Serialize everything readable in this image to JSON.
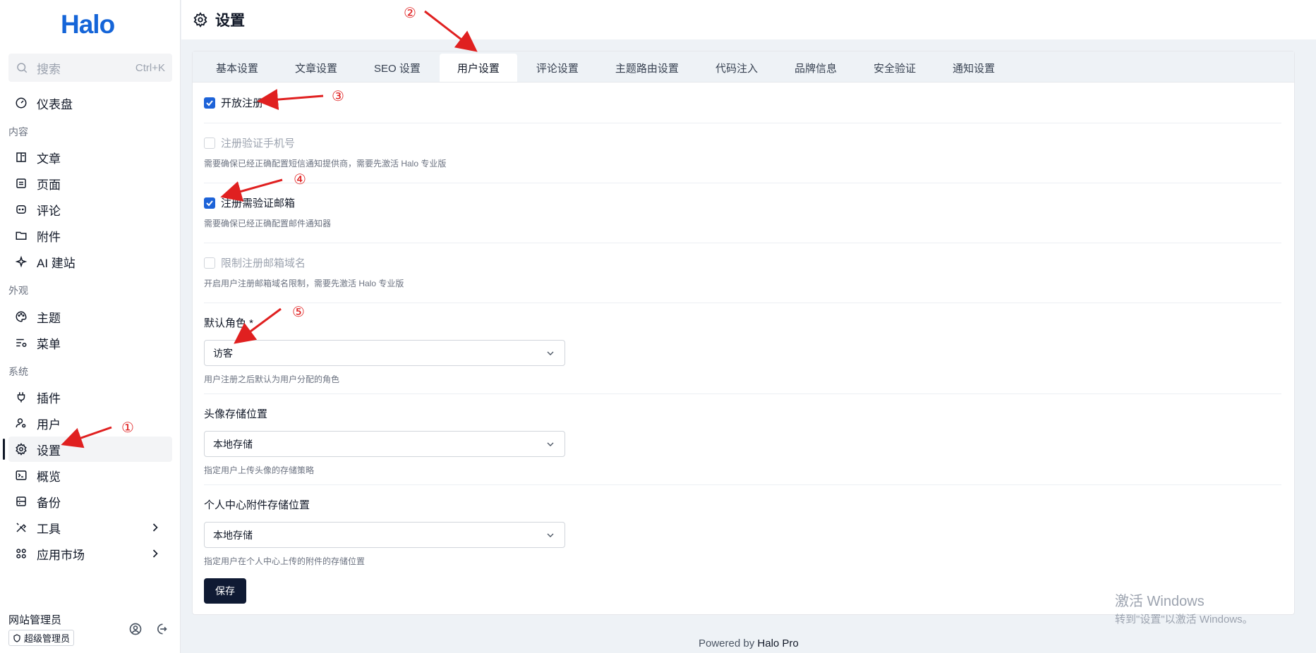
{
  "sidebar": {
    "logo": "Halo",
    "search": {
      "placeholder": "搜索",
      "shortcut": "Ctrl+K"
    },
    "dashboard": "仪表盘",
    "groups": {
      "content": "内容",
      "appearance": "外观",
      "system": "系统"
    },
    "items": {
      "posts": "文章",
      "pages": "页面",
      "comments": "评论",
      "attachments": "附件",
      "ai": "AI 建站",
      "themes": "主题",
      "menus": "菜单",
      "plugins": "插件",
      "users": "用户",
      "settings": "设置",
      "overview": "概览",
      "backup": "备份",
      "tools": "工具",
      "market": "应用市场"
    },
    "user": {
      "name": "网站管理员",
      "role": "超级管理员"
    }
  },
  "header": {
    "title": "设置"
  },
  "tabs": [
    "基本设置",
    "文章设置",
    "SEO 设置",
    "用户设置",
    "评论设置",
    "主题路由设置",
    "代码注入",
    "品牌信息",
    "安全验证",
    "通知设置"
  ],
  "active_tab": "用户设置",
  "form": {
    "open_registration": {
      "label": "开放注册",
      "checked": true
    },
    "phone_verify": {
      "label": "注册验证手机号",
      "checked": false,
      "help": "需要确保已经正确配置短信通知提供商，需要先激活 Halo 专业版"
    },
    "email_verify": {
      "label": "注册需验证邮箱",
      "checked": true,
      "help": "需要确保已经正确配置邮件通知器"
    },
    "email_domain": {
      "label": "限制注册邮箱域名",
      "checked": false,
      "help": "开启用户注册邮箱域名限制，需要先激活 Halo 专业版"
    },
    "default_role": {
      "label": "默认角色 *",
      "value": "访客",
      "help": "用户注册之后默认为用户分配的角色"
    },
    "avatar_storage": {
      "label": "头像存储位置",
      "value": "本地存储",
      "help": "指定用户上传头像的存储策略"
    },
    "center_storage": {
      "label": "个人中心附件存储位置",
      "value": "本地存储",
      "help": "指定用户在个人中心上传的附件的存储位置"
    },
    "save": "保存"
  },
  "footer": {
    "prefix": "Powered by ",
    "brand": "Halo Pro"
  },
  "watermark": {
    "line1": "激活 Windows",
    "line2": "转到\"设置\"以激活 Windows。"
  },
  "annotations": [
    "①",
    "②",
    "③",
    "④",
    "⑤"
  ],
  "colors": {
    "accent": "#1d63d8",
    "logo": "#1565d8",
    "annotation": "#e02020",
    "save_button": "#0f1a33"
  }
}
